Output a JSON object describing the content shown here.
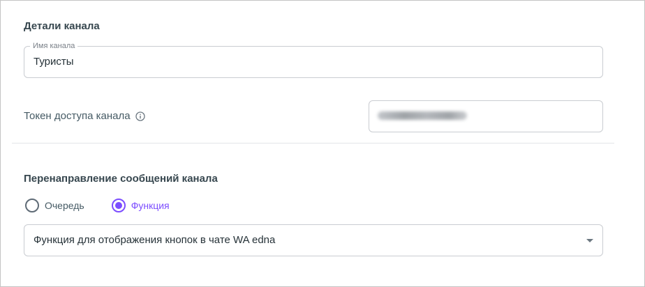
{
  "channel_details": {
    "section_title": "Детали канала",
    "name_field": {
      "legend": "Имя канала",
      "value": "Туристы"
    },
    "token": {
      "label": "Токен доступа канала",
      "icon": "info-icon"
    }
  },
  "redirect": {
    "section_title": "Перенаправление сообщений канала",
    "options": [
      {
        "label": "Очередь",
        "checked": false
      },
      {
        "label": "Функция",
        "checked": true
      }
    ],
    "selected_function": "Функция для отображения кнопок в чате WA edna"
  },
  "colors": {
    "accent": "#7c4dff",
    "border": "#c9ccd1",
    "text": "#263238"
  }
}
